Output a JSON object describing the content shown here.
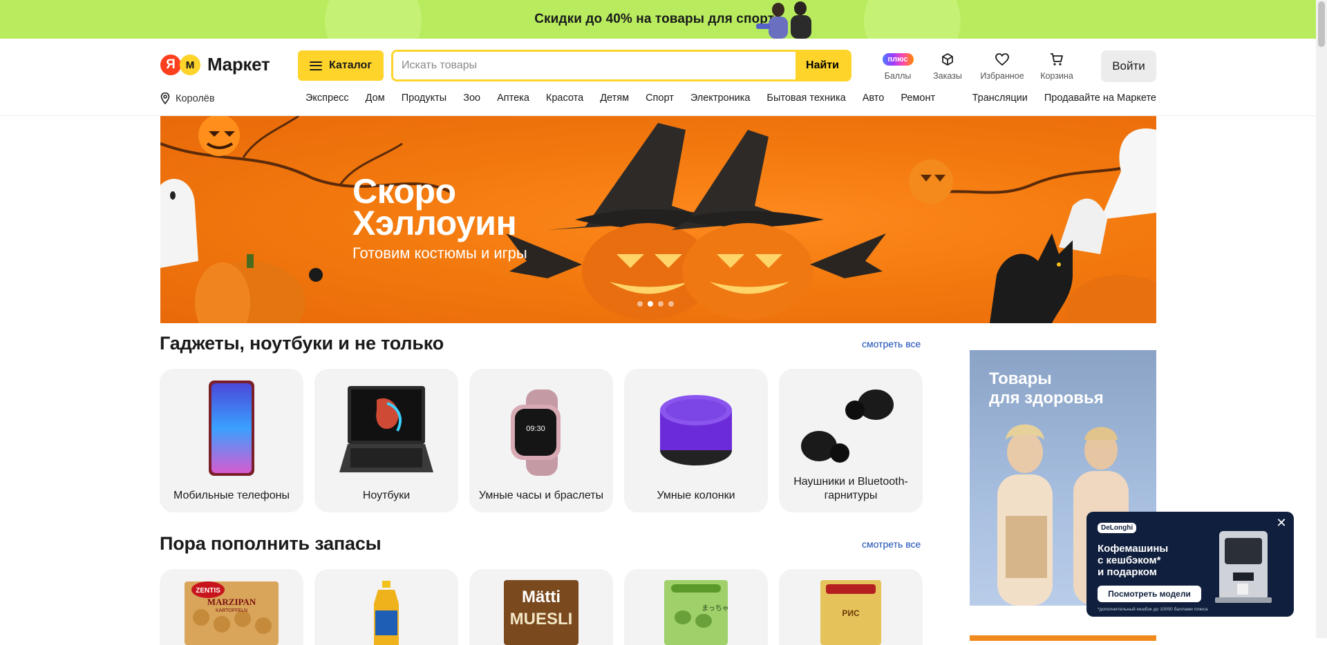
{
  "promo": {
    "text": "Скидки до 40% на товары для спорта"
  },
  "header": {
    "logo": {
      "ya": "Я",
      "m": "м",
      "word": "Маркет"
    },
    "catalog_label": "Каталог",
    "search": {
      "placeholder": "Искать товары",
      "value": "",
      "button": "Найти"
    },
    "icons": [
      {
        "name": "plus-badge",
        "badge": "плюс",
        "label": "Баллы"
      },
      {
        "name": "box-icon",
        "label": "Заказы"
      },
      {
        "name": "heart-icon",
        "label": "Избранное"
      },
      {
        "name": "cart-icon",
        "label": "Корзина"
      }
    ],
    "login_label": "Войти"
  },
  "nav": {
    "city": "Королёв",
    "categories": [
      "Экспресс",
      "Дом",
      "Продукты",
      "Зоо",
      "Аптека",
      "Красота",
      "Детям",
      "Спорт",
      "Электроника",
      "Бытовая техника",
      "Авто",
      "Ремонт"
    ],
    "right_links": [
      "Трансляции",
      "Продавайте на Маркете"
    ]
  },
  "hero": {
    "title_line1": "Скоро",
    "title_line2": "Хэллоуин",
    "subtitle": "Готовим костюмы и игры",
    "slide_count": 4,
    "active_slide": 2,
    "colors": {
      "background": "#f37a0e"
    }
  },
  "section1": {
    "title": "Гаджеты, ноутбуки и не только",
    "see_all": "смотреть все",
    "cards": [
      {
        "label": "Мобильные телефоны",
        "icon": "phone-image"
      },
      {
        "label": "Ноутбуки",
        "icon": "laptop-image"
      },
      {
        "label": "Умные часы и браслеты",
        "icon": "smartwatch-image"
      },
      {
        "label": "Умные колонки",
        "icon": "smart-speaker-image"
      },
      {
        "label": "Наушники и Bluetooth-гарнитуры",
        "icon": "earbuds-image"
      }
    ]
  },
  "section2": {
    "title": "Пора пополнить запасы",
    "see_all": "смотреть все",
    "cards": [
      {
        "product_text": "ZENTIS MARZIPAN KARTOFFELN",
        "icon": "marzipan-image"
      },
      {
        "product_text": "",
        "icon": "oil-bottle-image"
      },
      {
        "product_text": "Mätti MUESLI",
        "icon": "muesli-image"
      },
      {
        "product_text": "まっちゃ",
        "icon": "matcha-mochi-image"
      },
      {
        "product_text": "РИС",
        "icon": "rice-image"
      }
    ]
  },
  "side_ad": {
    "title_line1": "Товары",
    "title_line2": "для здоровья"
  },
  "popup": {
    "brand": "DeLonghi",
    "title_line1": "Кофемашины",
    "title_line2": "с кешбэком*",
    "title_line3": "и подарком",
    "button": "Посмотреть модели",
    "fine_print": "*дополнительный кешбэк до 10000 баллами плюса",
    "close": "✕"
  },
  "colors": {
    "accent": "#fed42b",
    "brand_red": "#fc3f1d",
    "link": "#1a4bb3",
    "promo_green": "#b8ec5e"
  }
}
